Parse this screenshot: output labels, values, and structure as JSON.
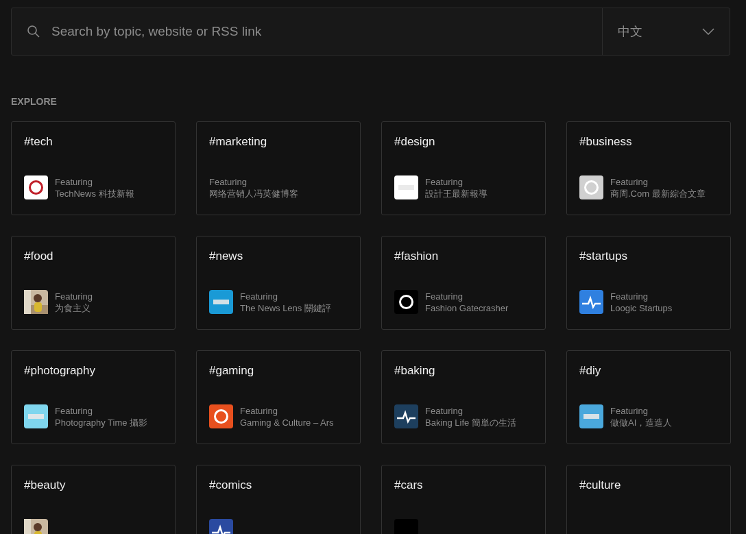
{
  "search": {
    "placeholder": "Search by topic, website or RSS link"
  },
  "language": {
    "value": "中文"
  },
  "section_title": "EXPLORE",
  "cards": [
    {
      "tag": "#tech",
      "featuring": "Featuring",
      "source": "TechNews 科技新報",
      "kind": "logo",
      "color": "#ffffff"
    },
    {
      "tag": "#marketing",
      "featuring": "Featuring",
      "source": "网络营销人冯英健博客",
      "kind": "none"
    },
    {
      "tag": "#design",
      "featuring": "Featuring",
      "source": "設計王最新報導",
      "kind": "logo",
      "color": "#ffffff"
    },
    {
      "tag": "#business",
      "featuring": "Featuring",
      "source": "商周.Com 最新綜合文章",
      "kind": "logo",
      "color": "#d0d0d0"
    },
    {
      "tag": "#food",
      "featuring": "Featuring",
      "source": "为食主义"
    },
    {
      "tag": "#news",
      "featuring": "Featuring",
      "source": "The News Lens 關鍵評",
      "kind": "logo",
      "color": "#1a9ad6"
    },
    {
      "tag": "#fashion",
      "featuring": "Featuring",
      "source": "Fashion Gatecrasher",
      "kind": "logo",
      "color": "#000000"
    },
    {
      "tag": "#startups",
      "featuring": "Featuring",
      "source": "Loogic Startups",
      "kind": "logo",
      "color": "#2f80e0"
    },
    {
      "tag": "#photography",
      "featuring": "Featuring",
      "source": "Photography Time 攝影",
      "kind": "logo",
      "color": "#7fd6ee"
    },
    {
      "tag": "#gaming",
      "featuring": "Featuring",
      "source": "Gaming & Culture – Ars",
      "kind": "logo",
      "color": "#e8501e"
    },
    {
      "tag": "#baking",
      "featuring": "Featuring",
      "source": "Baking Life 簡単の生活",
      "kind": "logo",
      "color": "#1d3f5e"
    },
    {
      "tag": "#diy",
      "featuring": "Featuring",
      "source": "做做AI，造造人",
      "kind": "logo",
      "color": "#4aa8dc"
    },
    {
      "tag": "#beauty"
    },
    {
      "tag": "#comics",
      "kind": "logo",
      "color": "#2a4aa0"
    },
    {
      "tag": "#cars",
      "kind": "logo",
      "color": "#000000"
    },
    {
      "tag": "#culture",
      "kind": "none"
    }
  ]
}
